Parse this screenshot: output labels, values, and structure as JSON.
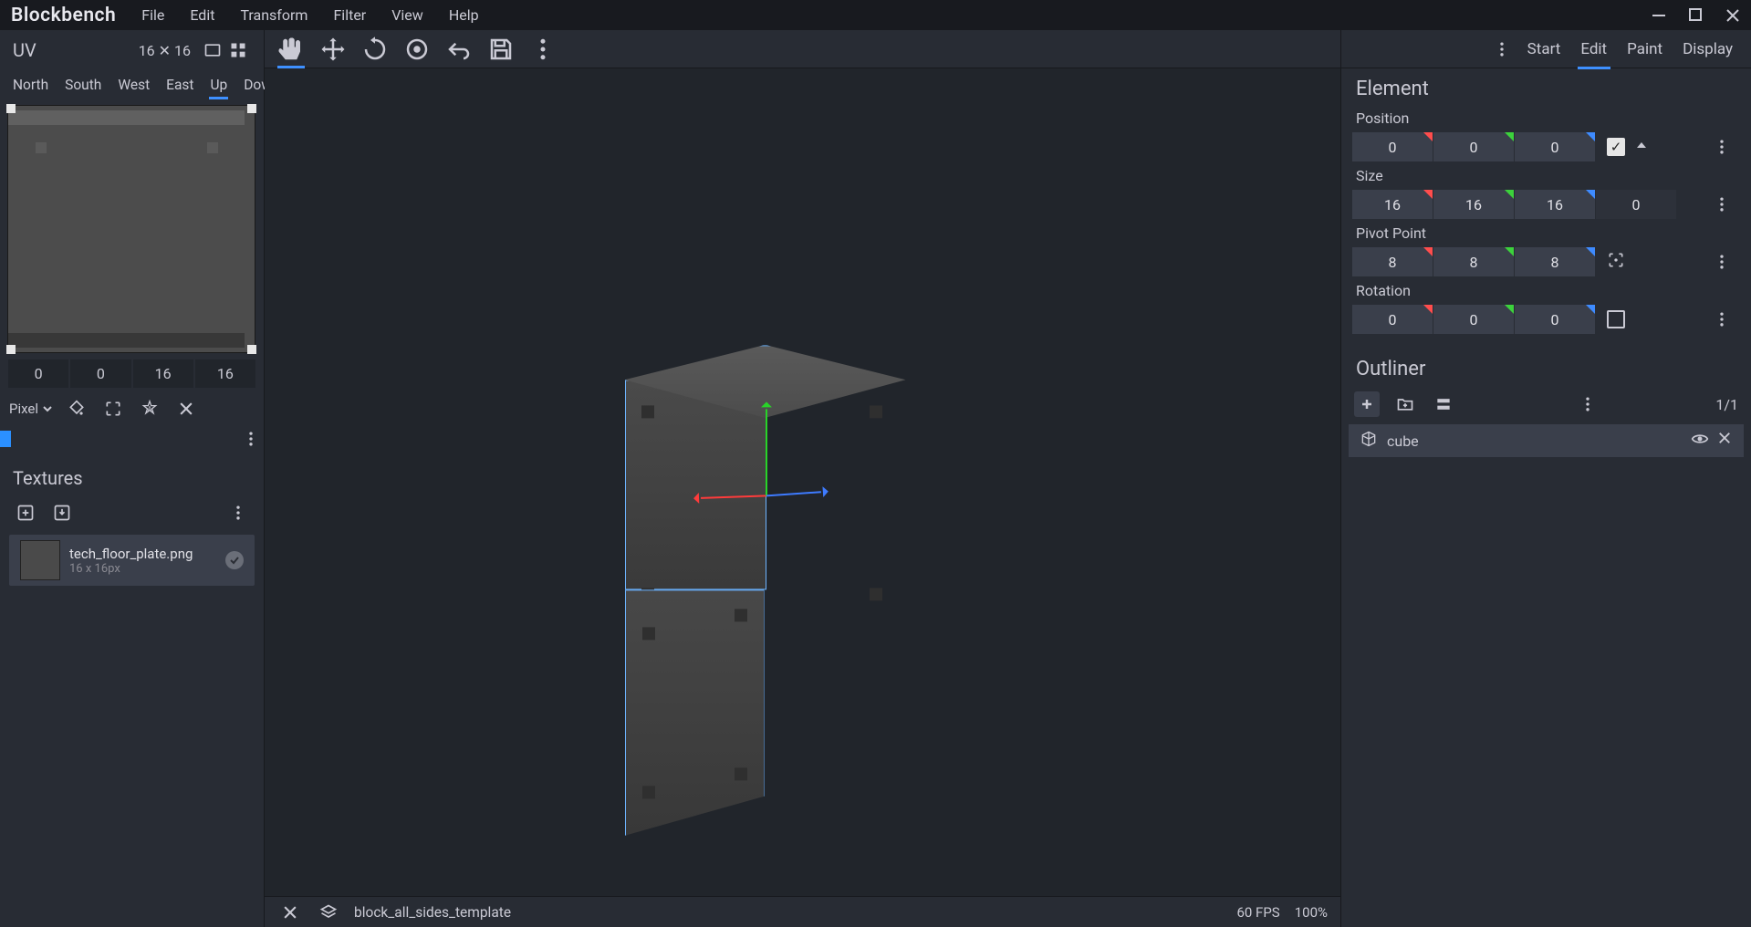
{
  "app": {
    "name": "Blockbench"
  },
  "menu": [
    "File",
    "Edit",
    "Transform",
    "Filter",
    "View",
    "Help"
  ],
  "modes": {
    "items": [
      "Start",
      "Edit",
      "Paint",
      "Display"
    ],
    "active": "Edit"
  },
  "uv": {
    "title": "UV",
    "size": "16 ✕ 16",
    "faces": [
      "North",
      "South",
      "West",
      "East",
      "Up",
      "Down"
    ],
    "active_face": "Up",
    "coords": [
      "0",
      "0",
      "16",
      "16"
    ],
    "brush_mode": "Pixel"
  },
  "textures": {
    "title": "Textures",
    "items": [
      {
        "name": "tech_floor_plate.png",
        "dims": "16 x 16px"
      }
    ]
  },
  "element": {
    "title": "Element",
    "position_label": "Position",
    "position": [
      "0",
      "0",
      "0"
    ],
    "size_label": "Size",
    "size": [
      "16",
      "16",
      "16",
      "0"
    ],
    "pivot_label": "Pivot Point",
    "pivot": [
      "8",
      "8",
      "8"
    ],
    "rotation_label": "Rotation",
    "rotation": [
      "0",
      "0",
      "0"
    ]
  },
  "outliner": {
    "title": "Outliner",
    "count": "1/1",
    "items": [
      {
        "name": "cube"
      }
    ]
  },
  "status": {
    "project": "block_all_sides_template",
    "fps": "60 FPS",
    "zoom": "100%"
  }
}
